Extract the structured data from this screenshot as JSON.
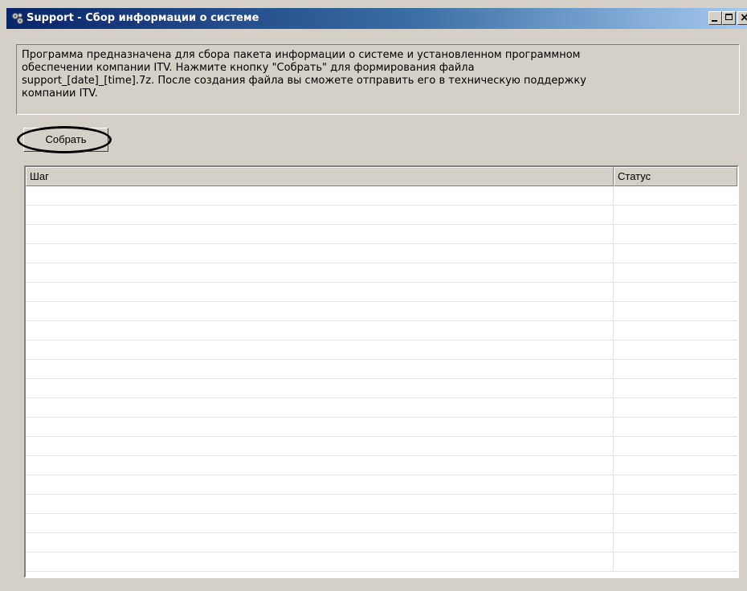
{
  "window": {
    "title": "Support - Сбор информации о системе",
    "icon": "gears-icon",
    "controls": {
      "minimize": "minimize-icon",
      "maximize": "maximize-icon",
      "close": "close-icon"
    }
  },
  "info": {
    "text": "Программа предназначена для сбора пакета информации о системе и установленном программном\nобеспечении компании ITV. Нажмите кнопку \"Собрать\" для формирования файла\nsupport_[date]_[time].7z. После создания файла вы сможете отправить его в техническую поддержку\nкомпании ITV."
  },
  "actions": {
    "collect_label": "Собрать"
  },
  "table": {
    "columns": [
      "Шаг",
      "Статус"
    ],
    "rows": []
  },
  "colors": {
    "titlebar_start": "#0a246a",
    "titlebar_end": "#a6caf0",
    "window_bg": "#d4d0c8"
  }
}
